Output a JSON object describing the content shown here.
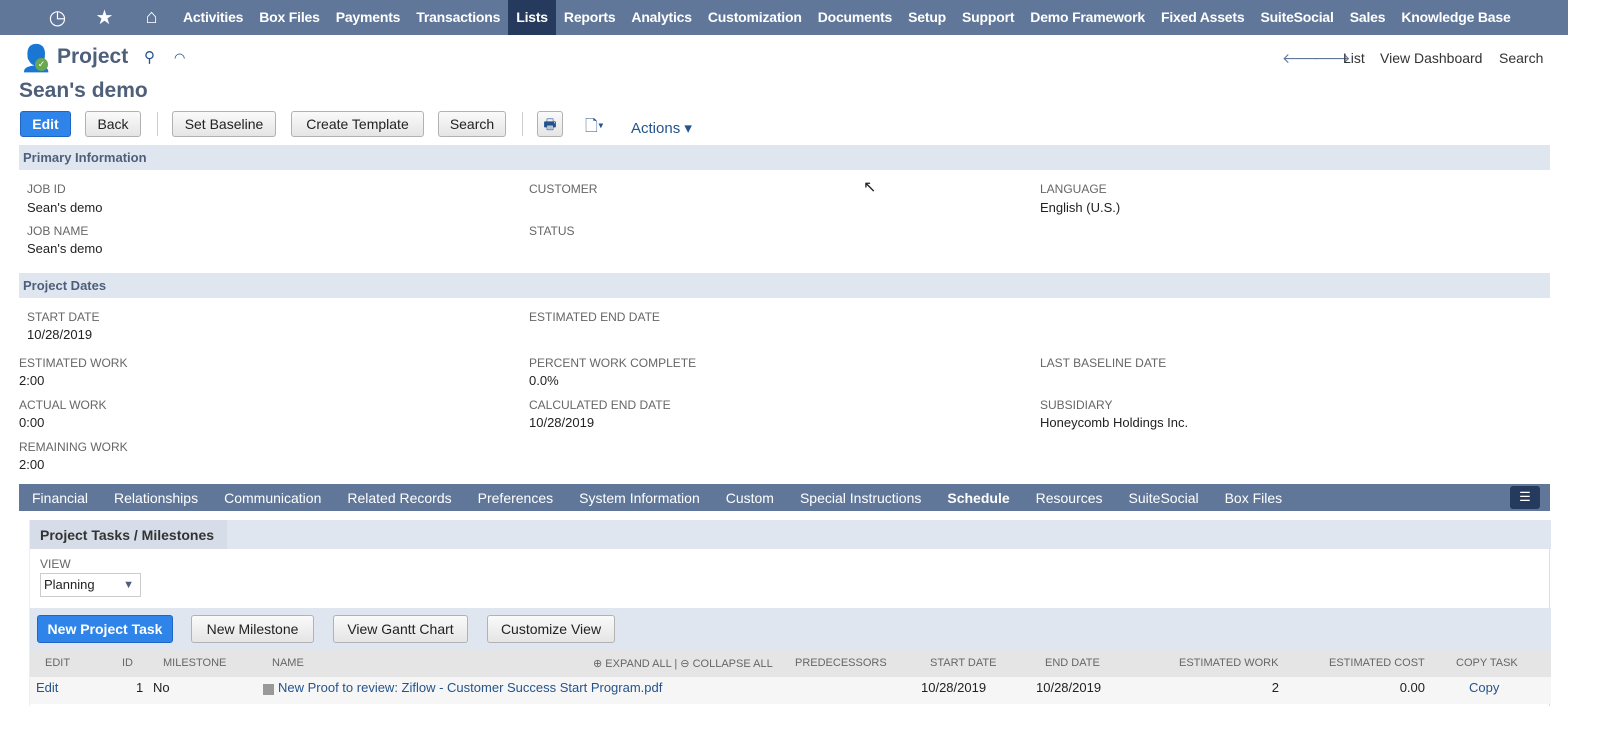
{
  "nav": {
    "items": [
      "Activities",
      "Box Files",
      "Payments",
      "Transactions",
      "Lists",
      "Reports",
      "Analytics",
      "Customization",
      "Documents",
      "Setup",
      "Support",
      "Demo Framework",
      "Fixed Assets",
      "SuiteSocial",
      "Sales",
      "Knowledge Base"
    ],
    "active": "Lists"
  },
  "header": {
    "record_type": "Project",
    "title": "Sean's demo",
    "links": {
      "list": "List",
      "dashboard": "View Dashboard",
      "search": "Search"
    }
  },
  "toolbar": {
    "edit": "Edit",
    "back": "Back",
    "set_baseline": "Set Baseline",
    "create_template": "Create Template",
    "search": "Search",
    "actions": "Actions"
  },
  "primary": {
    "heading": "Primary Information",
    "job_id_label": "JOB ID",
    "job_id": "Sean's demo",
    "customer_label": "CUSTOMER",
    "language_label": "LANGUAGE",
    "language": "English (U.S.)",
    "job_name_label": "JOB NAME",
    "job_name": "Sean's demo",
    "status_label": "STATUS"
  },
  "dates": {
    "heading": "Project Dates",
    "start_label": "START DATE",
    "start": "10/28/2019",
    "est_end_label": "ESTIMATED END DATE",
    "est_work_label": "ESTIMATED WORK",
    "est_work": "2:00",
    "pct_label": "PERCENT WORK COMPLETE",
    "pct": "0.0%",
    "baseline_label": "LAST BASELINE DATE",
    "actual_label": "ACTUAL WORK",
    "actual": "0:00",
    "calc_end_label": "CALCULATED END DATE",
    "calc_end": "10/28/2019",
    "subsidiary_label": "SUBSIDIARY",
    "subsidiary": "Honeycomb Holdings Inc.",
    "remaining_label": "REMAINING WORK",
    "remaining": "2:00"
  },
  "tabs": [
    "Financial",
    "Relationships",
    "Communication",
    "Related Records",
    "Preferences",
    "System Information",
    "Custom",
    "Special Instructions",
    "Schedule",
    "Resources",
    "SuiteSocial",
    "Box Files"
  ],
  "schedule": {
    "subtab": "Project Tasks / Milestones",
    "view_label": "VIEW",
    "view_value": "Planning",
    "buttons": {
      "new_task": "New Project Task",
      "new_milestone": "New Milestone",
      "gantt": "View Gantt Chart",
      "customize": "Customize View"
    },
    "expand_all": "EXPAND ALL",
    "collapse_all": "COLLAPSE ALL",
    "columns": [
      "EDIT",
      "ID",
      "MILESTONE",
      "NAME",
      "PREDECESSORS",
      "START DATE",
      "END DATE",
      "ESTIMATED WORK",
      "ESTIMATED COST",
      "COPY TASK"
    ],
    "rows": [
      {
        "edit": "Edit",
        "id": "1",
        "milestone": "No",
        "name": "New Proof to review: Ziflow - Customer Success Start Program.pdf",
        "predecessors": "",
        "start": "10/28/2019",
        "end": "10/28/2019",
        "est_work": "2",
        "est_cost": "0.00",
        "copy": "Copy"
      }
    ]
  }
}
